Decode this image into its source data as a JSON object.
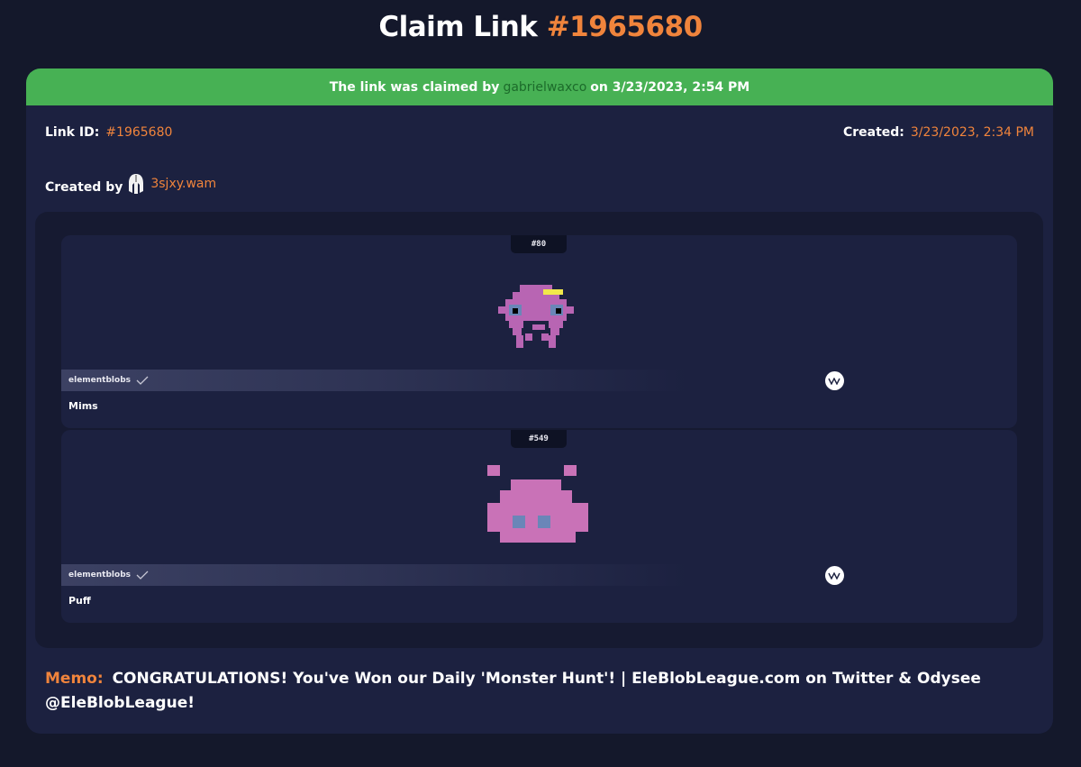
{
  "header": {
    "title_prefix": "Claim Link",
    "title_id": "#1965680"
  },
  "status": {
    "prefix": "The link was claimed by",
    "claimer": "gabrielwaxco",
    "suffix": "on 3/23/2023, 2:54 PM",
    "color": "#47b154"
  },
  "meta": {
    "link_id_label": "Link ID:",
    "link_id_value": "#1965680",
    "created_label": "Created:",
    "created_value": "3/23/2023, 2:34 PM"
  },
  "creator": {
    "label": "Created by",
    "name": "3sjxy.wam",
    "avatar_icon": "spartan-helmet-avatar"
  },
  "assets": [
    {
      "mint": "#80",
      "collection": "elementblobs",
      "verified_icon": "check-icon",
      "platform_icon": "wax-logo-icon",
      "name": "Mims"
    },
    {
      "mint": "#549",
      "collection": "elementblobs",
      "verified_icon": "check-icon",
      "platform_icon": "wax-logo-icon",
      "name": "Puff"
    }
  ],
  "memo": {
    "label": "Memo:",
    "text": "CONGRATULATIONS! You've Won our Daily 'Monster Hunt'! | EleBlobLeague.com on Twitter & Odysee @EleBlobLeague!"
  },
  "colors": {
    "accent": "#f0843c",
    "background": "#14182b",
    "card": "#1c2140",
    "success": "#47b154"
  }
}
